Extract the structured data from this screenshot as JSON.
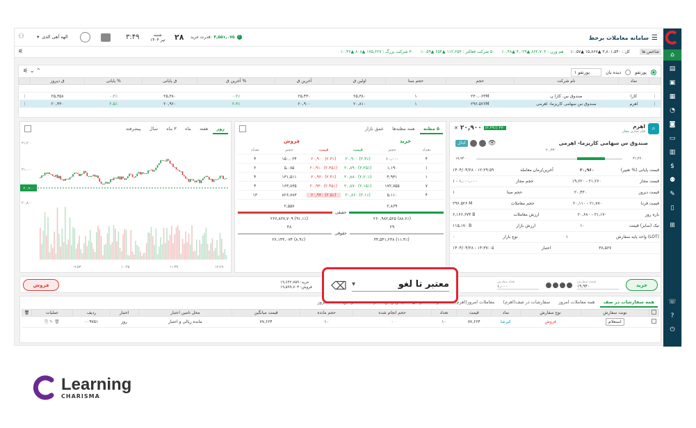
{
  "header": {
    "title": "سامانه معاملات برخط",
    "credit_label": "قدرت خرید:",
    "credit_value": "۴,۵۵۱,۰۷۵",
    "time": "۳:۴۹",
    "date_day": "شنبه",
    "date_num": "۲۸",
    "date_month": "تیر ۱۴۰۴",
    "user": "الهه آهی الذی"
  },
  "ticker": {
    "label": "شاخص ها",
    "items": [
      "کل : ۳,۸۰۱,۵۴۰ ▲۱۵,۸۶۷ ▲۰.۵۷٪",
      "هم وزن : ۸۶۲,۷۰۳ ▲۴,۰۲۹ ▲۰.۴۸٪",
      "۵۰ شرکت فعالتر : ۱۱۲,۲۵۳ ▲۶۵۴ ▲۰.۵۹٪",
      "۳۰ شرکت بزرگ : ۱۷۵,۶۲۷ ▲۸۰۸ ▲۰.۴۶٪"
    ]
  },
  "watchlist": {
    "radio1": "پورتفو",
    "radio2": "دیده بان",
    "select": "پورتفو ۱",
    "columns": [
      "نماد",
      "نام شرکت",
      "حجم",
      "حجم مبنا",
      "اولین ق",
      "آخرین ق",
      "% آخرین ق",
      "ق پایانی",
      "% پایانی",
      "ق دیروز"
    ],
    "rows": [
      {
        "symbol": "کارا",
        "name": "صندوق س. کارا ن",
        "vol": "۲۳۰,۰۶۳M",
        "base": "۱",
        "first": "۲۵,۳۸۰",
        "last": "۲۵,۴۳۰",
        "lastp": "۰.۲٪",
        "close": "۲۵,۳۸۰",
        "closep": "۰.۲٪",
        "prev": "۲۵,۳۵۸"
      },
      {
        "symbol": "اهرم",
        "name": "صندوق س سهامی کاریزما- اهرمی",
        "vol": "۲۹۶.۵۲۶M",
        "base": "۱",
        "first": "۲۰,۸۱۰",
        "last": "۲۰,۹۰۰",
        "lastp": "۲.۳٪",
        "close": "۲۰,۹۶۰",
        "closep": "۲.۵٪",
        "prev": "۲۰,۴۳۰"
      }
    ]
  },
  "symbol_panel": {
    "symbol": "اهرم",
    "subtitle": "قلم تجاری",
    "status": "مجاز",
    "name": "صندوق س سهامی کاریزما- اهرمی",
    "price": "۲۰,۹۰۰",
    "change": "(۲.۴۹٪) ۴۷۰",
    "tag": "کدال",
    "range_high": "۲۰,۴۳۰",
    "range_left": "۱۹,۹۴۰",
    "range_right": "۲۱,۲۶۰",
    "rows": [
      {
        "l": "قیمت پایانی (% تغییر)",
        "r": "۲۰,۹۶۰",
        "r2": "(۲.۵۰٪) ۵۳۰",
        "x": "۱۴۰۴/۰۴/۲۸ - ۱۲:۲۹:۵۹"
      },
      {
        "l": "قیمت مجاز",
        "r": "۱۹,۶۲۰ - ۲۱,۲۶۰",
        "x": "۱ - ۱,۰۰۰,۰۰۰"
      },
      {
        "l": "قیمت دیروز",
        "r": "۲۰,۴۳۰",
        "x": "۱"
      },
      {
        "l": "قیمت فردا",
        "r": "۲۰,۱۱۰ - ۲۱,۷۷۰",
        "x": "۲۹۶.۵۲۶ M"
      },
      {
        "l": "بازه روز",
        "r": "۲۰,۶۸۰ - ۲۱,۱۷۰",
        "x": "۶,۱۶۶.۶۷۴ B"
      },
      {
        "l": "تیک (سایز) قیمت",
        "r": "۱۰",
        "x": "۱۱۵,۱۷۰ B"
      },
      {
        "l": "واحد پایه سفارش (LOT)",
        "r": "۱",
        "x": "۰"
      },
      {
        "l": "",
        "r": "۳۸,۵۶۷",
        "x": "۱۴۰۴/۰۴/۲۸ - ۱۴:۳۷:۰۵"
      }
    ],
    "side_labels": [
      "آخرین/زمان معامله",
      "حجم مجاز",
      "حجم مبنا",
      "حجم معاملات",
      "ارزش معاملات",
      "ارزش بازار",
      "نوع بازار",
      "اعتبار"
    ]
  },
  "orderbook": {
    "tabs": [
      "۵ مظنه",
      "همه مظنه‌ها",
      "عمق بازار"
    ],
    "buy_title": "خرید",
    "sell_title": "فروش",
    "headers": [
      "تعداد",
      "حجم",
      "قیمت",
      "قیمت",
      "حجم",
      "تعداد"
    ],
    "rows": [
      [
        "۴",
        "۱۰,۰۰۰",
        "(۲.۳٪) ۲۰,۹۰۰",
        "(۲.۳٪) ۲۰,۹۰۰",
        "۱۵۰,۰۲۴",
        "۴"
      ],
      [
        "۱",
        "۱,۱۹۰",
        "(۲.۲۵٪) ۲۰,۸۹۰",
        "(۲.۳۵٪) ۲۰,۹۱۰",
        "۵,۰۸۵",
        "۲"
      ],
      [
        "۱",
        "۴,۹۳۱",
        "(۲.۲۰٪) ۲۰,۸۸۰",
        "(۲.۴٪) ۲۰,۹۲۰",
        "۱۳۱,۵۱۱",
        "۴"
      ],
      [
        "۷",
        "۱۷۲,۷۵۵",
        "(۲.۱۵٪) ۲۰,۸۷۰",
        "(۲.۴۵٪) ۲۰,۹۳۰",
        "۱۶۳,۸۳۵",
        "۴"
      ],
      [
        "۴",
        "۵,۱۱۰",
        "(۲.۱٪) ۲۰,۸۶۰",
        "(۲.۵٪) ۲۰,۹۴۰",
        "۸۲۶,۷۸۳",
        "۱۳"
      ]
    ],
    "real_label": "حقیقی",
    "legal_label": "حقوقی",
    "real_buy_count": "۲,۸۶۹",
    "real_sell_count": "۲,۵۵۷",
    "real_buy_vol": "۲۶۰,۹۸۲,۵۲۵ (۸۸.۶٪)",
    "real_sell_vol": "۲۶۶,۸۲۷,۷۰۹ (۹۱.۱٪)",
    "legal_buy_count": "۲۹",
    "legal_sell_count": "۴۸",
    "legal_buy_vol": "۳۴,۵۴۱,۲۳۸ (۱۱.۴٪)",
    "legal_sell_vol": "۲۶,۱۴۳,۰۷۴ (۸.۹٪)"
  },
  "chart": {
    "tabs": [
      "روز",
      "هفته",
      "ماه",
      "۳ ماه",
      "سال",
      "پیشرفته"
    ],
    "y_ticks": [
      "۲۱,۴۰۰",
      "۲۱,۰۰۰",
      "۲۰,۹۰۰",
      "۲۰,۸۰۰"
    ],
    "x_ticks": [
      "۰۹:۵۳",
      "۱۰:۴۵",
      "۱۱:۳۷",
      "۱۲:۲۹"
    ],
    "current": "۲۰,۹۰۰"
  },
  "order_bar": {
    "buy": "خرید",
    "sell": "فروش",
    "price_label": "قیمت سفارش",
    "price_value": "۱۹,۹۴۰",
    "qty_label": "تعداد سفارش",
    "qty_value": "۱,۰۰۰",
    "remain_label": "مانده",
    "buy_power_label": "خرید:",
    "buy_power_value": "۱۹,۶۴۲,۷۵۹",
    "sell_power_label": "فروش:",
    "sell_power_value": "۱۹,۵۹۹,۷۰۳",
    "validity": "معتبر تا لغو"
  },
  "orders": {
    "tabs": [
      "همه سفارشات در صف",
      "همه معاملات امروز",
      "سفارشات در صف(اهرم)",
      "معاملات امروز(اهرم)",
      "سفارشات شرطی",
      "پیش‌نویس سفارشات",
      "گردش حساب امروز"
    ],
    "columns": [
      "نوبت سفارش",
      "نوع سفارش",
      "نماد",
      "قیمت",
      "تعداد",
      "حجم انجام شده",
      "حجم مانده",
      "قیمت میانگین",
      "محل تامین اعتبار",
      "اعتبار",
      "ردیف",
      "عملیات"
    ],
    "row": {
      "queue": "استعلام",
      "type": "فروش",
      "symbol": "کپرشا",
      "price": "۷۷,۶۶۴",
      "qty": "۱۰",
      "done": "۰",
      "remain": "۱۰",
      "avg": "۷۷,۶۶۴",
      "source": "مانده ریالی و اعتبار",
      "validity": "روز",
      "idx": "۰۰۹۷۵۱"
    }
  },
  "footer": {
    "brand": "Learning",
    "sub": "CHARISMA"
  },
  "colors": {
    "green": "#1a9a4a",
    "red": "#d83a3a",
    "navy": "#0d3b4f",
    "accent": "#e02431"
  }
}
